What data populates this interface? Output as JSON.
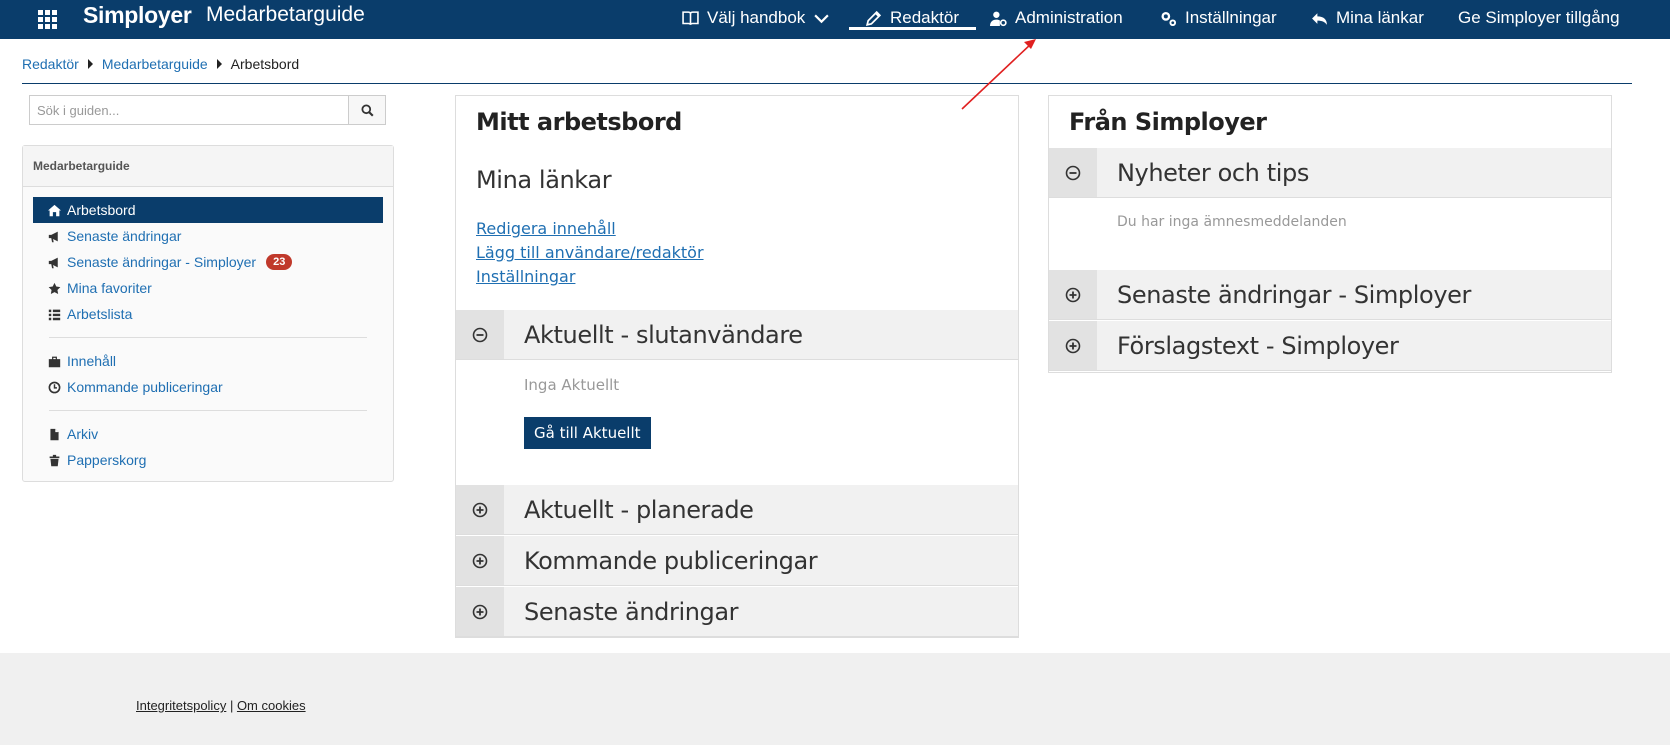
{
  "header": {
    "brand": "Simployer",
    "app_title": "Medarbetarguide",
    "nav": [
      {
        "label": "Välj handbok",
        "icon": "book-icon"
      },
      {
        "label": "Redaktör",
        "icon": "pencil-icon"
      },
      {
        "label": "Administration",
        "icon": "user-gear-icon"
      },
      {
        "label": "Inställningar",
        "icon": "gears-icon"
      },
      {
        "label": "Mina länkar",
        "icon": "reply-arrow-icon"
      },
      {
        "label": "Ge Simployer tillgång",
        "icon": ""
      }
    ],
    "active_nav": "Redaktör"
  },
  "breadcrumb": [
    "Redaktör",
    "Medarbetarguide",
    "Arbetsbord"
  ],
  "search": {
    "placeholder": "Sök i guiden..."
  },
  "sidebar": {
    "heading": "Medarbetarguide",
    "groups": [
      [
        {
          "label": "Arbetsbord",
          "icon": "home-icon",
          "active": true
        },
        {
          "label": "Senaste ändringar",
          "icon": "megaphone-icon"
        },
        {
          "label": "Senaste ändringar - Simployer",
          "icon": "megaphone-icon",
          "badge": "23"
        },
        {
          "label": "Mina favoriter",
          "icon": "star-icon"
        },
        {
          "label": "Arbetslista",
          "icon": "list-icon"
        }
      ],
      [
        {
          "label": "Innehåll",
          "icon": "briefcase-icon"
        },
        {
          "label": "Kommande publiceringar",
          "icon": "clock-icon"
        }
      ],
      [
        {
          "label": "Arkiv",
          "icon": "file-icon"
        },
        {
          "label": "Papperskorg",
          "icon": "trash-icon"
        }
      ]
    ]
  },
  "workbench": {
    "title": "Mitt arbetsbord",
    "links_title": "Mina länkar",
    "links": [
      "Redigera innehåll",
      "Lägg till användare/redaktör",
      "Inställningar"
    ],
    "sections": [
      {
        "label": "Aktuellt - slutanvändare",
        "expanded": true,
        "empty_text": "Inga Aktuellt",
        "button": "Gå till Aktuellt"
      },
      {
        "label": "Aktuellt - planerade",
        "expanded": false
      },
      {
        "label": "Kommande publiceringar",
        "expanded": false
      },
      {
        "label": "Senaste ändringar",
        "expanded": false
      }
    ]
  },
  "from_simployer": {
    "title": "Från Simployer",
    "sections": [
      {
        "label": "Nyheter och tips",
        "expanded": true,
        "empty_text": "Du har inga ämnesmeddelanden"
      },
      {
        "label": "Senaste ändringar - Simployer",
        "expanded": false
      },
      {
        "label": "Förslagstext - Simployer",
        "expanded": false
      }
    ]
  },
  "footer": {
    "privacy": "Integritetspolicy",
    "separator": " | ",
    "cookies": "Om cookies"
  },
  "colors": {
    "primary": "#0a3d6b",
    "link": "#1f6fb2",
    "badge": "#c0392b",
    "annotation": "#e02020"
  }
}
